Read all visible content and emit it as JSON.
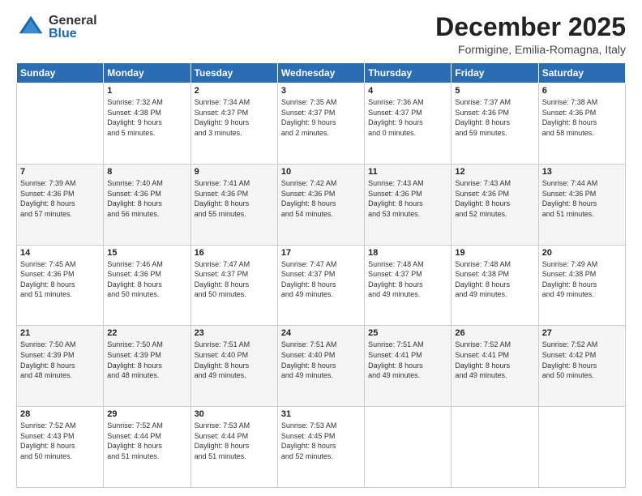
{
  "header": {
    "logo_general": "General",
    "logo_blue": "Blue",
    "title": "December 2025",
    "subtitle": "Formigine, Emilia-Romagna, Italy"
  },
  "calendar": {
    "days_of_week": [
      "Sunday",
      "Monday",
      "Tuesday",
      "Wednesday",
      "Thursday",
      "Friday",
      "Saturday"
    ],
    "weeks": [
      [
        {
          "day": "",
          "info": ""
        },
        {
          "day": "1",
          "info": "Sunrise: 7:32 AM\nSunset: 4:38 PM\nDaylight: 9 hours\nand 5 minutes."
        },
        {
          "day": "2",
          "info": "Sunrise: 7:34 AM\nSunset: 4:37 PM\nDaylight: 9 hours\nand 3 minutes."
        },
        {
          "day": "3",
          "info": "Sunrise: 7:35 AM\nSunset: 4:37 PM\nDaylight: 9 hours\nand 2 minutes."
        },
        {
          "day": "4",
          "info": "Sunrise: 7:36 AM\nSunset: 4:37 PM\nDaylight: 9 hours\nand 0 minutes."
        },
        {
          "day": "5",
          "info": "Sunrise: 7:37 AM\nSunset: 4:36 PM\nDaylight: 8 hours\nand 59 minutes."
        },
        {
          "day": "6",
          "info": "Sunrise: 7:38 AM\nSunset: 4:36 PM\nDaylight: 8 hours\nand 58 minutes."
        }
      ],
      [
        {
          "day": "7",
          "info": "Sunrise: 7:39 AM\nSunset: 4:36 PM\nDaylight: 8 hours\nand 57 minutes."
        },
        {
          "day": "8",
          "info": "Sunrise: 7:40 AM\nSunset: 4:36 PM\nDaylight: 8 hours\nand 56 minutes."
        },
        {
          "day": "9",
          "info": "Sunrise: 7:41 AM\nSunset: 4:36 PM\nDaylight: 8 hours\nand 55 minutes."
        },
        {
          "day": "10",
          "info": "Sunrise: 7:42 AM\nSunset: 4:36 PM\nDaylight: 8 hours\nand 54 minutes."
        },
        {
          "day": "11",
          "info": "Sunrise: 7:43 AM\nSunset: 4:36 PM\nDaylight: 8 hours\nand 53 minutes."
        },
        {
          "day": "12",
          "info": "Sunrise: 7:43 AM\nSunset: 4:36 PM\nDaylight: 8 hours\nand 52 minutes."
        },
        {
          "day": "13",
          "info": "Sunrise: 7:44 AM\nSunset: 4:36 PM\nDaylight: 8 hours\nand 51 minutes."
        }
      ],
      [
        {
          "day": "14",
          "info": "Sunrise: 7:45 AM\nSunset: 4:36 PM\nDaylight: 8 hours\nand 51 minutes."
        },
        {
          "day": "15",
          "info": "Sunrise: 7:46 AM\nSunset: 4:36 PM\nDaylight: 8 hours\nand 50 minutes."
        },
        {
          "day": "16",
          "info": "Sunrise: 7:47 AM\nSunset: 4:37 PM\nDaylight: 8 hours\nand 50 minutes."
        },
        {
          "day": "17",
          "info": "Sunrise: 7:47 AM\nSunset: 4:37 PM\nDaylight: 8 hours\nand 49 minutes."
        },
        {
          "day": "18",
          "info": "Sunrise: 7:48 AM\nSunset: 4:37 PM\nDaylight: 8 hours\nand 49 minutes."
        },
        {
          "day": "19",
          "info": "Sunrise: 7:48 AM\nSunset: 4:38 PM\nDaylight: 8 hours\nand 49 minutes."
        },
        {
          "day": "20",
          "info": "Sunrise: 7:49 AM\nSunset: 4:38 PM\nDaylight: 8 hours\nand 49 minutes."
        }
      ],
      [
        {
          "day": "21",
          "info": "Sunrise: 7:50 AM\nSunset: 4:39 PM\nDaylight: 8 hours\nand 48 minutes."
        },
        {
          "day": "22",
          "info": "Sunrise: 7:50 AM\nSunset: 4:39 PM\nDaylight: 8 hours\nand 48 minutes."
        },
        {
          "day": "23",
          "info": "Sunrise: 7:51 AM\nSunset: 4:40 PM\nDaylight: 8 hours\nand 49 minutes."
        },
        {
          "day": "24",
          "info": "Sunrise: 7:51 AM\nSunset: 4:40 PM\nDaylight: 8 hours\nand 49 minutes."
        },
        {
          "day": "25",
          "info": "Sunrise: 7:51 AM\nSunset: 4:41 PM\nDaylight: 8 hours\nand 49 minutes."
        },
        {
          "day": "26",
          "info": "Sunrise: 7:52 AM\nSunset: 4:41 PM\nDaylight: 8 hours\nand 49 minutes."
        },
        {
          "day": "27",
          "info": "Sunrise: 7:52 AM\nSunset: 4:42 PM\nDaylight: 8 hours\nand 50 minutes."
        }
      ],
      [
        {
          "day": "28",
          "info": "Sunrise: 7:52 AM\nSunset: 4:43 PM\nDaylight: 8 hours\nand 50 minutes."
        },
        {
          "day": "29",
          "info": "Sunrise: 7:52 AM\nSunset: 4:44 PM\nDaylight: 8 hours\nand 51 minutes."
        },
        {
          "day": "30",
          "info": "Sunrise: 7:53 AM\nSunset: 4:44 PM\nDaylight: 8 hours\nand 51 minutes."
        },
        {
          "day": "31",
          "info": "Sunrise: 7:53 AM\nSunset: 4:45 PM\nDaylight: 8 hours\nand 52 minutes."
        },
        {
          "day": "",
          "info": ""
        },
        {
          "day": "",
          "info": ""
        },
        {
          "day": "",
          "info": ""
        }
      ]
    ]
  }
}
